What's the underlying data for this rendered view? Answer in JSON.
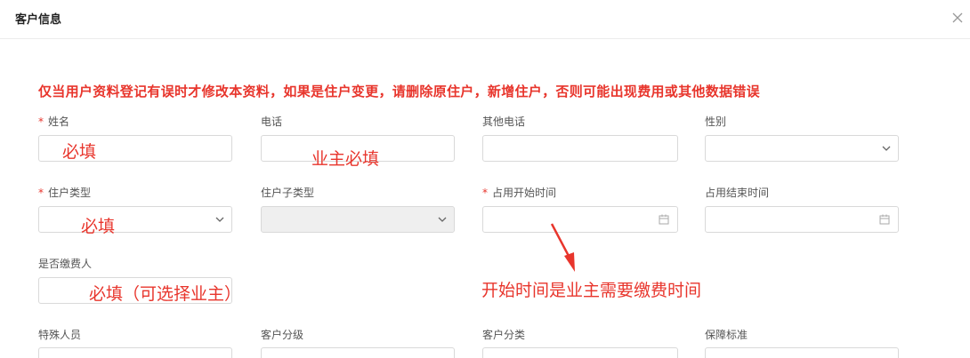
{
  "dialog": {
    "title": "客户信息"
  },
  "warning": "仅当用户资料登记有误时才修改本资料，如果是住户变更，请删除原住户，新增住户，否则可能出现费用或其他数据错误",
  "required_mark": "*",
  "fields": {
    "name": {
      "label": "姓名",
      "required": true,
      "value": ""
    },
    "phone": {
      "label": "电话",
      "value": ""
    },
    "other_phone": {
      "label": "其他电话",
      "value": ""
    },
    "gender": {
      "label": "性别",
      "value": ""
    },
    "resident_type": {
      "label": "住户类型",
      "required": true,
      "value": ""
    },
    "resident_subtype": {
      "label": "住户子类型",
      "value": "",
      "disabled": true
    },
    "start_time": {
      "label": "占用开始时间",
      "required": true,
      "value": ""
    },
    "end_time": {
      "label": "占用结束时间",
      "value": ""
    },
    "payer": {
      "label": "是否缴费人",
      "value": ""
    },
    "special": {
      "label": "特殊人员"
    },
    "level": {
      "label": "客户分级"
    },
    "category": {
      "label": "客户分类"
    },
    "standard": {
      "label": "保障标准"
    }
  },
  "annotations": {
    "name_note": "必填",
    "phone_note": "业主必填",
    "type_note": "必填",
    "payer_note": "必填（可选择业主）",
    "start_note": "开始时间是业主需要缴费时间"
  },
  "colors": {
    "annotation": "#e8352c",
    "border": "#d9d9d9",
    "disabled_bg": "#efefef"
  },
  "icons": {
    "close": "close-icon",
    "dropdown": "chevron-down-icon",
    "date": "calendar-icon"
  }
}
